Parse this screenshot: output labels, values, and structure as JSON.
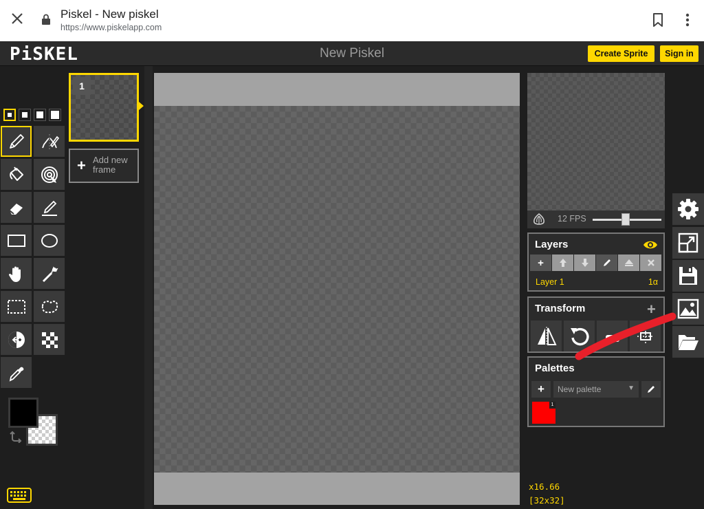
{
  "browser": {
    "page_title": "Piskel - New piskel",
    "url": "https://www.piskelapp.com"
  },
  "header": {
    "logo": "PiSKEL",
    "title": "New Piskel",
    "create_sprite_label": "Create Sprite",
    "sign_in_label": "Sign in"
  },
  "colors": {
    "accent": "#ffd700",
    "primary_color": "#000000",
    "palette_color": "#ff0000",
    "annotation_stroke": "#e8202a"
  },
  "tools": {
    "pen_sizes": [
      "1",
      "2",
      "3",
      "4"
    ],
    "active_tool": "pen-tool",
    "items": [
      "pen-icon",
      "vertical-mirror-pen-icon",
      "paint-bucket-icon",
      "paint-same-pixels-icon",
      "eraser-icon",
      "stroke-icon",
      "rectangle-icon",
      "circle-icon",
      "move-hand-icon",
      "shape-selection-icon",
      "rectangle-selection-icon",
      "lasso-selection-icon",
      "lighten-icon",
      "dithering-icon",
      "color-picker-icon"
    ]
  },
  "frames": {
    "items": [
      {
        "number": "1"
      }
    ],
    "add_frame_label": "Add new frame"
  },
  "animation": {
    "fps_label": "12 FPS",
    "fps_value": 12
  },
  "layers": {
    "title": "Layers",
    "items": [
      {
        "name": "Layer 1",
        "alpha": "1α"
      }
    ]
  },
  "transform": {
    "title": "Transform",
    "plus": "+"
  },
  "palettes": {
    "title": "Palettes",
    "selected": "New palette",
    "swatches": [
      {
        "color": "#ff0000",
        "index": "1"
      }
    ]
  },
  "status": {
    "zoom": "x16.66",
    "size": "[32x32]"
  }
}
